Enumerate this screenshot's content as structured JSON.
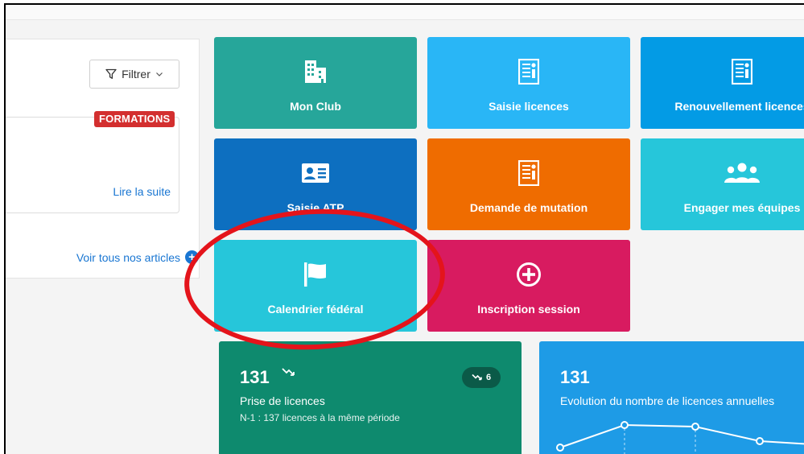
{
  "news": {
    "filter_label": "Filtrer",
    "badge": "FORMATIONS",
    "read_more": "Lire la suite",
    "see_all": "Voir tous nos articles"
  },
  "tiles": [
    {
      "label": "Mon Club",
      "icon": "building-icon",
      "color": "#26a69a"
    },
    {
      "label": "Saisie licences",
      "icon": "license-document-icon",
      "color": "#29b6f6"
    },
    {
      "label": "Renouvellement licences",
      "icon": "license-document-icon",
      "color": "#039be5"
    },
    {
      "label": "Saisie ATP",
      "icon": "id-card-icon",
      "color": "#0d6fc0"
    },
    {
      "label": "Demande de mutation",
      "icon": "license-document-icon",
      "color": "#ef6c00"
    },
    {
      "label": "Engager mes équipes",
      "icon": "group-icon",
      "color": "#26c6da"
    },
    {
      "label": "Calendrier fédéral",
      "icon": "flag-icon",
      "color": "#26c6da"
    },
    {
      "label": "Inscription session",
      "icon": "plus-circle-icon",
      "color": "#d81b60"
    }
  ],
  "stats": {
    "licences": {
      "value": "131",
      "title": "Prise de licences",
      "subtitle": "N-1 : 137 licences à la même période",
      "trend_delta": "6",
      "color": "#0e8a6e"
    },
    "evolution": {
      "value": "131",
      "title": "Evolution du nombre de licences annuelles",
      "color": "#1e9be6"
    }
  },
  "annotation": {
    "color": "#e4141b"
  }
}
